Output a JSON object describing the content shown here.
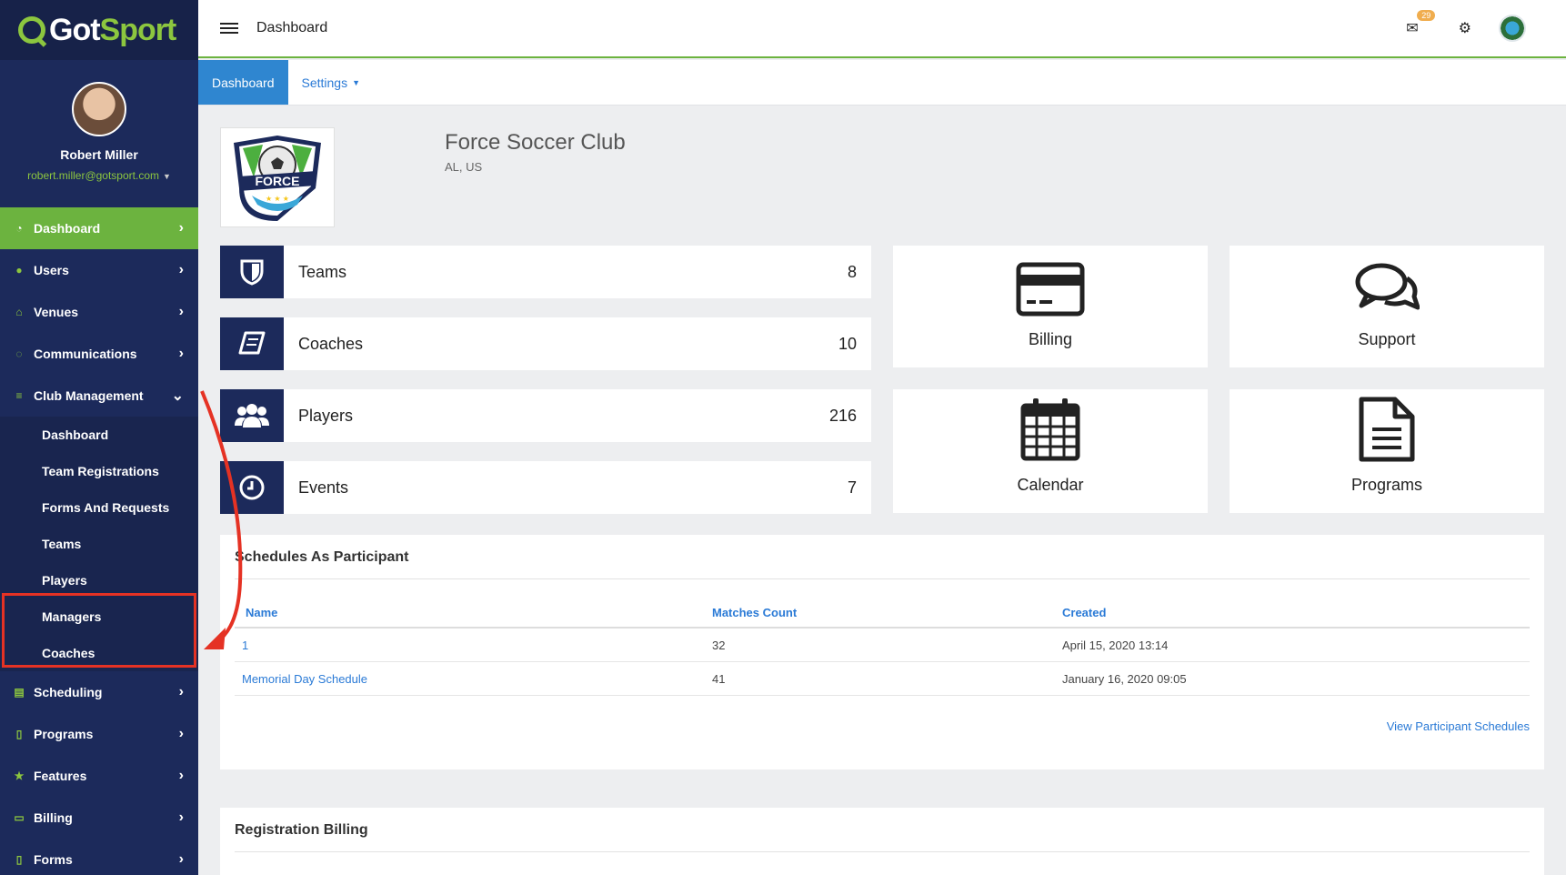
{
  "brand": {
    "part1": "Got",
    "part2": "Sport"
  },
  "profile": {
    "name": "Robert Miller",
    "email": "robert.miller@gotsport.com"
  },
  "sidebar": {
    "items": [
      {
        "label": "Dashboard",
        "icon": "dashboard-icon",
        "glyph": "◔"
      },
      {
        "label": "Users",
        "icon": "users-icon",
        "glyph": "●"
      },
      {
        "label": "Venues",
        "icon": "venues-icon",
        "glyph": "⌂"
      },
      {
        "label": "Communications",
        "icon": "comments-icon",
        "glyph": "◌"
      },
      {
        "label": "Club Management",
        "icon": "club-management-icon",
        "glyph": "≡"
      }
    ],
    "sub_items": [
      {
        "label": "Dashboard"
      },
      {
        "label": "Team Registrations"
      },
      {
        "label": "Forms And Requests"
      },
      {
        "label": "Teams"
      },
      {
        "label": "Players"
      },
      {
        "label": "Managers"
      },
      {
        "label": "Coaches"
      }
    ],
    "items_after": [
      {
        "label": "Scheduling",
        "icon": "scheduling-icon",
        "glyph": "▤"
      },
      {
        "label": "Programs",
        "icon": "programs-icon",
        "glyph": "▯"
      },
      {
        "label": "Features",
        "icon": "star-icon",
        "glyph": "★"
      },
      {
        "label": "Billing",
        "icon": "credit-card-icon",
        "glyph": "▭"
      },
      {
        "label": "Forms",
        "icon": "file-icon",
        "glyph": "▯"
      }
    ]
  },
  "topbar": {
    "title": "Dashboard",
    "mail_badge": "29"
  },
  "tabs": {
    "dashboard": "Dashboard",
    "settings": "Settings"
  },
  "club": {
    "name": "Force Soccer Club",
    "location": "AL, US",
    "logo_text": "FORCE"
  },
  "stats": [
    {
      "label": "Teams",
      "count": "8",
      "icon": "shield-icon"
    },
    {
      "label": "Coaches",
      "count": "10",
      "icon": "book-icon"
    },
    {
      "label": "Players",
      "count": "216",
      "icon": "users-icon"
    },
    {
      "label": "Events",
      "count": "7",
      "icon": "clock-icon"
    }
  ],
  "tiles": {
    "billing": "Billing",
    "support": "Support",
    "calendar": "Calendar",
    "programs": "Programs"
  },
  "schedules": {
    "title": "Schedules As Participant",
    "columns": {
      "name": "Name",
      "matches": "Matches Count",
      "created": "Created"
    },
    "rows": [
      {
        "name": "1",
        "matches": "32",
        "created": "April 15, 2020 13:14"
      },
      {
        "name": "Memorial Day Schedule",
        "matches": "41",
        "created": "January 16, 2020 09:05"
      }
    ],
    "footer_link": "View Participant Schedules"
  },
  "registration_billing": {
    "title": "Registration Billing"
  },
  "colors": {
    "sidebar": "#1c2a5b",
    "accent_green": "#6cb33f",
    "link_blue": "#2a7ad6",
    "highlight_red": "#e53224"
  }
}
